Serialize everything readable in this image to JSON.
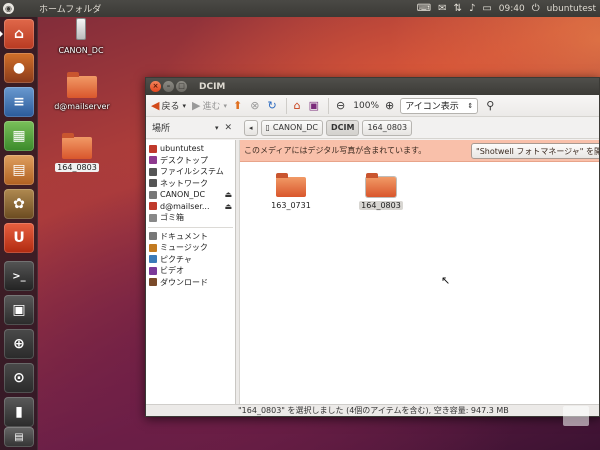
{
  "top_panel": {
    "title": "ホームフォルダ",
    "time": "09:40",
    "user": "ubuntutest"
  },
  "desktop_icons": [
    {
      "label": "CANON_DC",
      "icon": "usb-drive-icon"
    },
    {
      "label": "d@mailserver",
      "icon": "network-share-icon"
    },
    {
      "label": "164_0803",
      "icon": "folder-icon"
    }
  ],
  "window": {
    "title": "DCIM",
    "toolbar": {
      "back": "戻る",
      "forward": "進む",
      "zoom": "100%",
      "view_mode": "アイコン表示"
    },
    "places_header": "場所",
    "path": [
      "CANON_DC",
      "DCIM",
      "164_0803"
    ],
    "sidebar": {
      "devices": [
        {
          "label": "ubuntutest",
          "color": "#c0392b",
          "eject": false
        },
        {
          "label": "デスクトップ",
          "color": "#8e3a8e",
          "eject": false
        },
        {
          "label": "ファイルシステム",
          "color": "#555555",
          "eject": false
        },
        {
          "label": "ネットワーク",
          "color": "#555555",
          "eject": false
        },
        {
          "label": "CANON_DC",
          "color": "#777777",
          "eject": true
        },
        {
          "label": "d@mailser...",
          "color": "#c0392b",
          "eject": true
        },
        {
          "label": "ゴミ箱",
          "color": "#888888",
          "eject": false
        }
      ],
      "bookmarks": [
        {
          "label": "ドキュメント",
          "color": "#777777"
        },
        {
          "label": "ミュージック",
          "color": "#c27a20"
        },
        {
          "label": "ピクチャ",
          "color": "#3a7ab8"
        },
        {
          "label": "ビデオ",
          "color": "#7a3a9a"
        },
        {
          "label": "ダウンロード",
          "color": "#7a4a2a"
        }
      ]
    },
    "infobar": {
      "message": "このメディアにはデジタル写真が含まれています。",
      "button": "\"Shotwell フォトマネージャ\" を開"
    },
    "files": [
      {
        "label": "163_0731",
        "selected": false
      },
      {
        "label": "164_0803",
        "selected": true
      }
    ],
    "status": "\"164_0803\" を選択しました (4個のアイテムを含む), 空き容量: 947.3 MB"
  }
}
